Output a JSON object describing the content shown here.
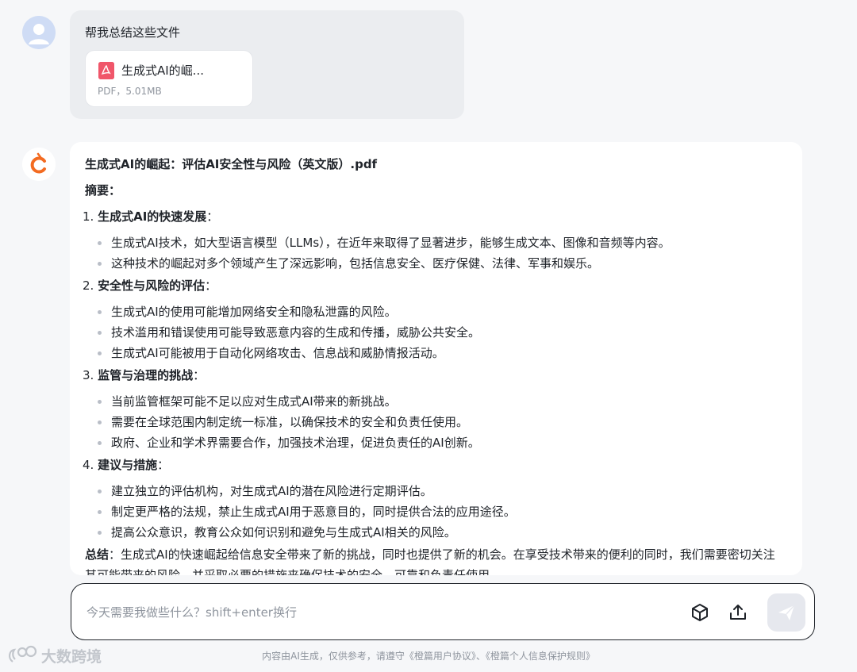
{
  "user_message": {
    "text": "帮我总结这些文件",
    "file": {
      "name": "生成式AI的崛...",
      "meta": "PDF，5.01MB",
      "icon": "pdf-icon"
    }
  },
  "ai_message": {
    "title": "生成式AI的崛起：评估AI安全性与风险（英文版）.pdf",
    "abstract_label": "摘要",
    "sections": [
      {
        "number": "1.",
        "heading": "生成式AI的快速发展",
        "items": [
          "生成式AI技术，如大型语言模型（LLMs），在近年来取得了显著进步，能够生成文本、图像和音频等内容。",
          "这种技术的崛起对多个领域产生了深远影响，包括信息安全、医疗保健、法律、军事和娱乐。"
        ]
      },
      {
        "number": "2.",
        "heading": "安全性与风险的评估",
        "items": [
          "生成式AI的使用可能增加网络安全和隐私泄露的风险。",
          "技术滥用和错误使用可能导致恶意内容的生成和传播，威胁公共安全。",
          "生成式AI可能被用于自动化网络攻击、信息战和威胁情报活动。"
        ]
      },
      {
        "number": "3.",
        "heading": "监管与治理的挑战",
        "items": [
          "当前监管框架可能不足以应对生成式AI带来的新挑战。",
          "需要在全球范围内制定统一标准，以确保技术的安全和负责任使用。",
          "政府、企业和学术界需要合作，加强技术治理，促进负责任的AI创新。"
        ]
      },
      {
        "number": "4.",
        "heading": "建议与措施",
        "items": [
          "建立独立的评估机构，对生成式AI的潜在风险进行定期评估。",
          "制定更严格的法规，禁止生成式AI用于恶意目的，同时提供合法的应用途径。",
          "提高公众意识，教育公众如何识别和避免与生成式AI相关的风险。"
        ]
      }
    ],
    "summary_label": "总结",
    "summary_text": "生成式AI的快速崛起给信息安全带来了新的挑战，同时也提供了新的机会。在享受技术带来的便利的同时，我们需要密切关注其可能带来的风险，并采取必要的措施来确保技术的安全、可靠和负责任使用。"
  },
  "input": {
    "placeholder": "今天需要我做些什么？shift+enter换行",
    "value": "",
    "tools": [
      "cube-icon",
      "upload-icon"
    ],
    "send_icon": "send-icon"
  },
  "footer": {
    "note": "内容由AI生成，仅供参考，请遵守《橙篇用户协议》、《橙篇个人信息保护规则》"
  },
  "watermark": {
    "text": "大数跨境"
  },
  "colors": {
    "background": "#f6f7f9",
    "user_bubble": "#ebedf0",
    "ai_bubble": "#ffffff",
    "pdf_red": "#f0566a",
    "brand_orange": "#f36b21",
    "send_disabled": "#e6e8ee"
  }
}
